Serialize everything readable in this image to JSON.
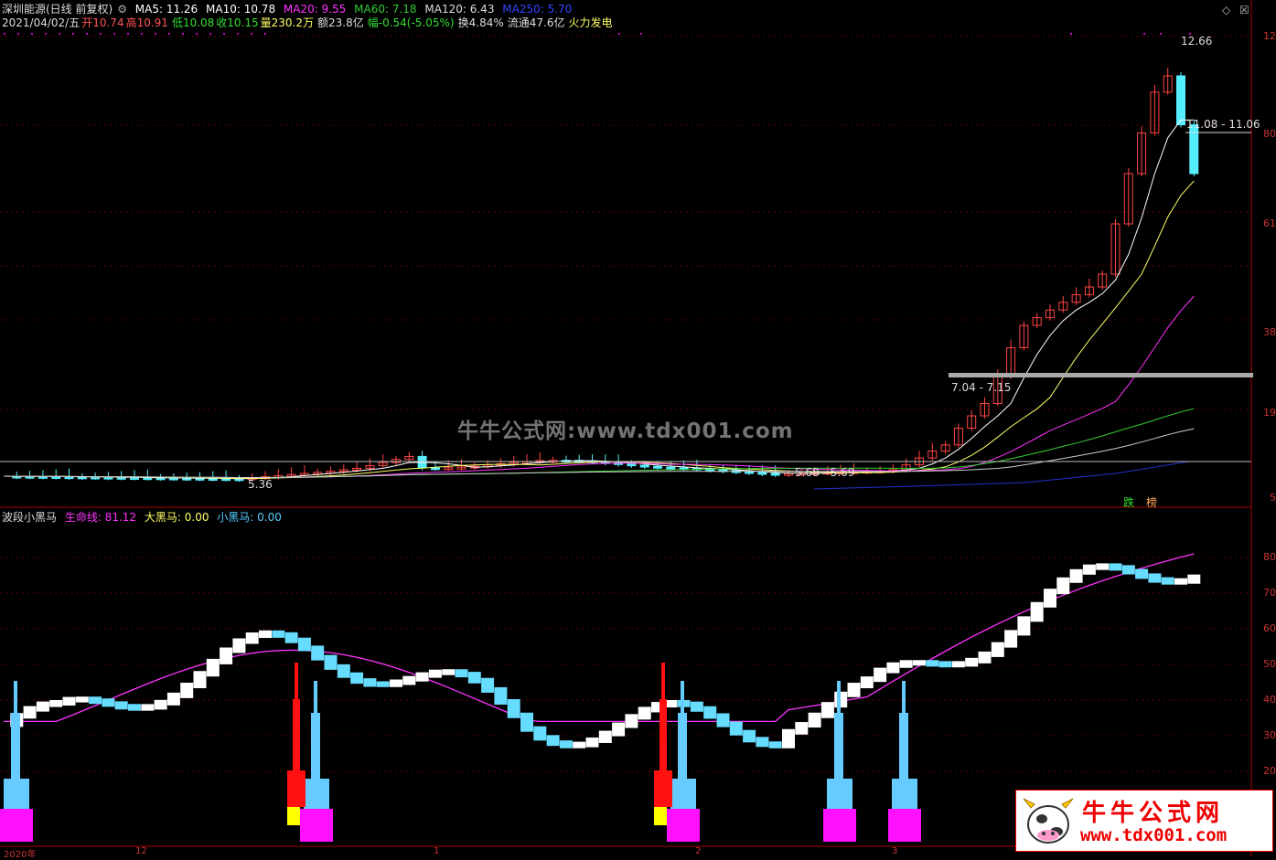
{
  "header": {
    "stock": "深圳能源(日线 前复权)",
    "ma5": "MA5: 11.26",
    "ma10": "MA10: 10.78",
    "ma20": "MA20: 9.55",
    "ma60": "MA60: 7.18",
    "ma120": "MA120: 6.43",
    "ma250": "MA250: 5.70",
    "date": "2021/04/02/五",
    "open": "开10.74",
    "high": "高10.91",
    "low": "低10.08",
    "close": "收10.15",
    "vol": "量230.2万",
    "amount": "额23.8亿",
    "change": "幅-0.54(-5.05%)",
    "turnover": "换4.84%",
    "float": "流通47.6亿",
    "sector": "火力发电"
  },
  "indicator": {
    "name": "波段小黑马",
    "life": "生命线: 81.12",
    "big": "大黑马: 0.00",
    "small": "小黑马: 0.00"
  },
  "annotations": {
    "high": "12.66",
    "resist": "11.08 - 11.06",
    "support": "7.04 - 7.15",
    "low": "5.36",
    "base": "5.68 - 5.69",
    "tag1": "跌",
    "tag2": "榜"
  },
  "price_axis": [
    "12",
    "80",
    "61",
    "38",
    "19",
    "5"
  ],
  "ind_axis": [
    "80",
    "70",
    "60",
    "50",
    "40",
    "30",
    "20"
  ],
  "x_labels": [
    "2020年",
    "12",
    "1",
    "2",
    "3"
  ],
  "controls": {
    "diamond": "◇",
    "close": "☒"
  },
  "watermark": "牛牛公式网:www.tdx001.com",
  "logo": {
    "cn": "牛牛公式网",
    "url": "www.tdx001.com"
  },
  "colors": {
    "ma5": "#ffffff",
    "ma10": "#ffff66",
    "ma20": "#ff33ff",
    "ma60": "#33cc33",
    "ma120": "#cccccc",
    "ma250": "#2233cc",
    "up": "#ff4444",
    "down": "#55eeff"
  }
}
